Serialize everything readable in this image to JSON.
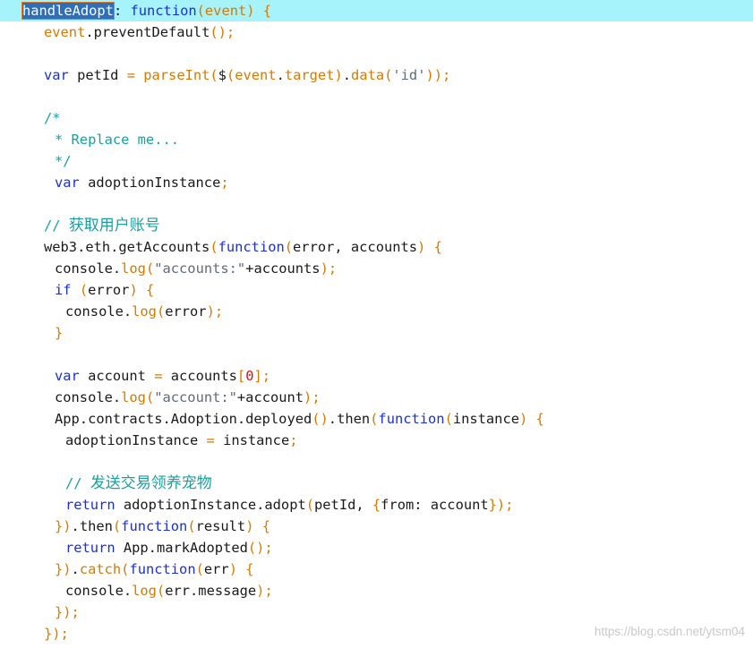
{
  "colors": {
    "plain": "#1a1a1a",
    "keyword": "#1a2fd6",
    "variable": "#d67a00",
    "function": "#d67a00",
    "comment": "#18a0a0",
    "string": "#5f6b78",
    "number": "#d11414",
    "punct": "#d67a00",
    "active_line": "#a6f3fb",
    "selection": "#2f6eb8"
  },
  "code": {
    "lines": [
      {
        "indent": 0,
        "highlight": true,
        "tokens": [
          {
            "t": "handleAdopt",
            "c": "sel"
          },
          {
            "t": ": ",
            "c": "plain"
          },
          {
            "t": "function",
            "c": "keyword"
          },
          {
            "t": "(",
            "c": "punct"
          },
          {
            "t": "event",
            "c": "variable"
          },
          {
            "t": ") {",
            "c": "punct"
          }
        ]
      },
      {
        "indent": 2,
        "tokens": [
          {
            "t": "event",
            "c": "variable"
          },
          {
            "t": ".preventDefault",
            "c": "plain"
          },
          {
            "t": "();",
            "c": "punct"
          }
        ]
      },
      {
        "indent": 0,
        "tokens": []
      },
      {
        "indent": 2,
        "tokens": [
          {
            "t": "var",
            "c": "keyword"
          },
          {
            "t": " petId ",
            "c": "plain"
          },
          {
            "t": "=",
            "c": "punct"
          },
          {
            "t": " ",
            "c": "plain"
          },
          {
            "t": "parseInt",
            "c": "function"
          },
          {
            "t": "(",
            "c": "punct"
          },
          {
            "t": "$",
            "c": "plain"
          },
          {
            "t": "(",
            "c": "punct"
          },
          {
            "t": "event",
            "c": "variable"
          },
          {
            "t": ".",
            "c": "plain"
          },
          {
            "t": "target",
            "c": "variable"
          },
          {
            "t": ")",
            "c": "punct"
          },
          {
            "t": ".",
            "c": "plain"
          },
          {
            "t": "data",
            "c": "function"
          },
          {
            "t": "(",
            "c": "punct"
          },
          {
            "t": "'id'",
            "c": "string"
          },
          {
            "t": "));",
            "c": "punct"
          }
        ]
      },
      {
        "indent": 0,
        "tokens": []
      },
      {
        "indent": 2,
        "tokens": [
          {
            "t": "/*",
            "c": "comment"
          }
        ]
      },
      {
        "indent": 3,
        "tokens": [
          {
            "t": "* Replace me...",
            "c": "comment"
          }
        ]
      },
      {
        "indent": 3,
        "tokens": [
          {
            "t": "*/",
            "c": "comment"
          }
        ]
      },
      {
        "indent": 3,
        "tokens": [
          {
            "t": "var",
            "c": "keyword"
          },
          {
            "t": " adoptionInstance",
            "c": "plain"
          },
          {
            "t": ";",
            "c": "punct"
          }
        ]
      },
      {
        "indent": 0,
        "tokens": []
      },
      {
        "indent": 2,
        "tokens": [
          {
            "t": "// ",
            "c": "comment"
          },
          {
            "t": "获取用户账号",
            "c": "comment",
            "cjk": true
          }
        ]
      },
      {
        "indent": 2,
        "tokens": [
          {
            "t": "web3.eth.getAccounts",
            "c": "plain"
          },
          {
            "t": "(",
            "c": "punct"
          },
          {
            "t": "function",
            "c": "keyword"
          },
          {
            "t": "(",
            "c": "punct"
          },
          {
            "t": "error, accounts",
            "c": "plain"
          },
          {
            "t": ") {",
            "c": "punct"
          }
        ]
      },
      {
        "indent": 3,
        "tokens": [
          {
            "t": "console.",
            "c": "plain"
          },
          {
            "t": "log",
            "c": "function"
          },
          {
            "t": "(",
            "c": "punct"
          },
          {
            "t": "\"accounts:\"",
            "c": "string"
          },
          {
            "t": "+accounts",
            "c": "plain"
          },
          {
            "t": ");",
            "c": "punct"
          }
        ]
      },
      {
        "indent": 3,
        "tokens": [
          {
            "t": "if",
            "c": "keyword"
          },
          {
            "t": " (",
            "c": "punct"
          },
          {
            "t": "error",
            "c": "plain"
          },
          {
            "t": ") {",
            "c": "punct"
          }
        ]
      },
      {
        "indent": 4,
        "tokens": [
          {
            "t": "console.",
            "c": "plain"
          },
          {
            "t": "log",
            "c": "function"
          },
          {
            "t": "(",
            "c": "punct"
          },
          {
            "t": "error",
            "c": "plain"
          },
          {
            "t": ");",
            "c": "punct"
          }
        ]
      },
      {
        "indent": 3,
        "tokens": [
          {
            "t": "}",
            "c": "punct"
          }
        ]
      },
      {
        "indent": 0,
        "tokens": []
      },
      {
        "indent": 3,
        "tokens": [
          {
            "t": "var",
            "c": "keyword"
          },
          {
            "t": " account ",
            "c": "plain"
          },
          {
            "t": "=",
            "c": "punct"
          },
          {
            "t": " accounts",
            "c": "plain"
          },
          {
            "t": "[",
            "c": "punct"
          },
          {
            "t": "0",
            "c": "number"
          },
          {
            "t": "];",
            "c": "punct"
          }
        ]
      },
      {
        "indent": 3,
        "tokens": [
          {
            "t": "console.",
            "c": "plain"
          },
          {
            "t": "log",
            "c": "function"
          },
          {
            "t": "(",
            "c": "punct"
          },
          {
            "t": "\"account:\"",
            "c": "string"
          },
          {
            "t": "+account",
            "c": "plain"
          },
          {
            "t": ");",
            "c": "punct"
          }
        ]
      },
      {
        "indent": 3,
        "tokens": [
          {
            "t": "App.contracts.Adoption.deployed",
            "c": "plain"
          },
          {
            "t": "()",
            "c": "punct"
          },
          {
            "t": ".then",
            "c": "plain"
          },
          {
            "t": "(",
            "c": "punct"
          },
          {
            "t": "function",
            "c": "keyword"
          },
          {
            "t": "(",
            "c": "punct"
          },
          {
            "t": "instance",
            "c": "plain"
          },
          {
            "t": ") {",
            "c": "punct"
          }
        ]
      },
      {
        "indent": 4,
        "tokens": [
          {
            "t": "adoptionInstance ",
            "c": "plain"
          },
          {
            "t": "=",
            "c": "punct"
          },
          {
            "t": " instance",
            "c": "plain"
          },
          {
            "t": ";",
            "c": "punct"
          }
        ]
      },
      {
        "indent": 0,
        "tokens": []
      },
      {
        "indent": 4,
        "tokens": [
          {
            "t": "// ",
            "c": "comment"
          },
          {
            "t": "发送交易领养宠物",
            "c": "comment",
            "cjk": true
          }
        ]
      },
      {
        "indent": 4,
        "tokens": [
          {
            "t": "return",
            "c": "keyword"
          },
          {
            "t": " adoptionInstance.adopt",
            "c": "plain"
          },
          {
            "t": "(",
            "c": "punct"
          },
          {
            "t": "petId, ",
            "c": "plain"
          },
          {
            "t": "{",
            "c": "punct"
          },
          {
            "t": "from: account",
            "c": "plain"
          },
          {
            "t": "});",
            "c": "punct"
          }
        ]
      },
      {
        "indent": 3,
        "tokens": [
          {
            "t": "})",
            "c": "punct"
          },
          {
            "t": ".then",
            "c": "plain"
          },
          {
            "t": "(",
            "c": "punct"
          },
          {
            "t": "function",
            "c": "keyword"
          },
          {
            "t": "(",
            "c": "punct"
          },
          {
            "t": "result",
            "c": "plain"
          },
          {
            "t": ") {",
            "c": "punct"
          }
        ]
      },
      {
        "indent": 4,
        "tokens": [
          {
            "t": "return",
            "c": "keyword"
          },
          {
            "t": " App.markAdopted",
            "c": "plain"
          },
          {
            "t": "();",
            "c": "punct"
          }
        ]
      },
      {
        "indent": 3,
        "tokens": [
          {
            "t": "})",
            "c": "punct"
          },
          {
            "t": ".",
            "c": "plain"
          },
          {
            "t": "catch",
            "c": "function"
          },
          {
            "t": "(",
            "c": "punct"
          },
          {
            "t": "function",
            "c": "keyword"
          },
          {
            "t": "(",
            "c": "punct"
          },
          {
            "t": "err",
            "c": "plain"
          },
          {
            "t": ") {",
            "c": "punct"
          }
        ]
      },
      {
        "indent": 4,
        "tokens": [
          {
            "t": "console.",
            "c": "plain"
          },
          {
            "t": "log",
            "c": "function"
          },
          {
            "t": "(",
            "c": "punct"
          },
          {
            "t": "err.message",
            "c": "plain"
          },
          {
            "t": ");",
            "c": "punct"
          }
        ]
      },
      {
        "indent": 3,
        "tokens": [
          {
            "t": "});",
            "c": "punct"
          }
        ]
      },
      {
        "indent": 2,
        "tokens": [
          {
            "t": "});",
            "c": "punct"
          }
        ]
      }
    ]
  },
  "watermark": {
    "text": "https://blog.csdn.net/ytsm04"
  }
}
